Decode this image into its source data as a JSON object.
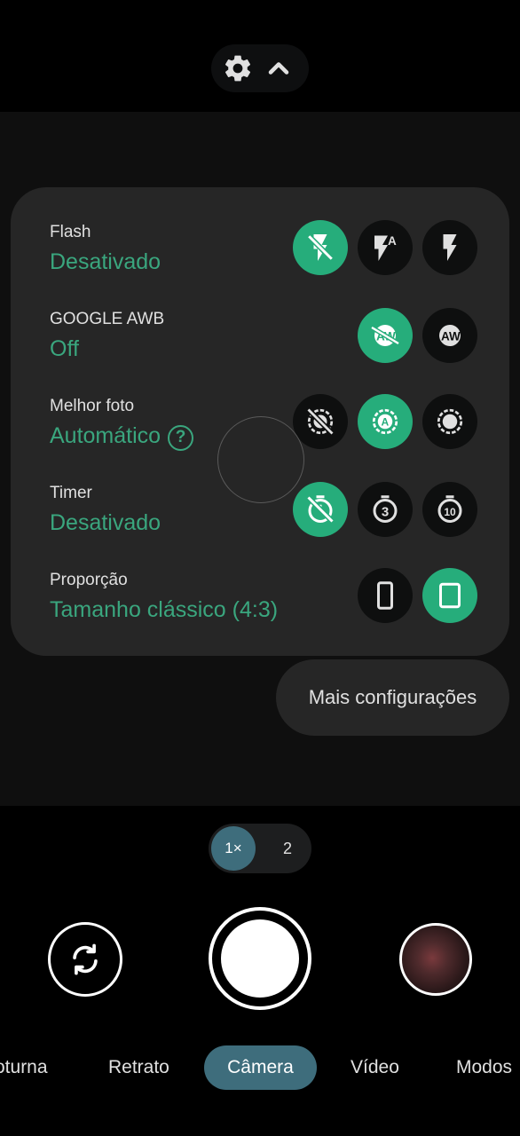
{
  "settings_panel": {
    "rows": [
      {
        "label": "Flash",
        "value": "Desativado"
      },
      {
        "label": "GOOGLE AWB",
        "value": "Off"
      },
      {
        "label": "Melhor foto",
        "value": "Automático",
        "help_icon": "help-circle-icon"
      },
      {
        "label": "Timer",
        "value": "Desativado"
      },
      {
        "label": "Proporção",
        "value": "Tamanho clássico (4:3)"
      }
    ],
    "flash_options": [
      {
        "icon": "flash-off-icon",
        "selected": true
      },
      {
        "icon": "flash-auto-icon",
        "selected": false,
        "glyph": "A"
      },
      {
        "icon": "flash-on-icon",
        "selected": false
      }
    ],
    "awb_options": [
      {
        "icon": "awb-off-icon",
        "selected": true,
        "glyph": "AW"
      },
      {
        "icon": "awb-on-icon",
        "selected": false,
        "glyph": "AW"
      }
    ],
    "best_photo_options": [
      {
        "icon": "motion-off-icon",
        "selected": false
      },
      {
        "icon": "motion-auto-icon",
        "selected": true,
        "glyph": "A"
      },
      {
        "icon": "motion-on-icon",
        "selected": false
      }
    ],
    "timer_options": [
      {
        "icon": "timer-off-icon",
        "selected": true
      },
      {
        "icon": "timer-3-icon",
        "selected": false,
        "glyph": "3"
      },
      {
        "icon": "timer-10-icon",
        "selected": false,
        "glyph": "10"
      }
    ],
    "ratio_options": [
      {
        "icon": "ratio-wide-icon",
        "selected": false
      },
      {
        "icon": "ratio-classic-icon",
        "selected": true
      }
    ]
  },
  "more_settings": "Mais configurações",
  "zoom": {
    "current": "1×",
    "other": "2"
  },
  "modes": [
    "oturna",
    "Retrato",
    "Câmera",
    "Vídeo",
    "Modos"
  ],
  "active_mode": "Câmera",
  "colors": {
    "accent": "#26ad7b",
    "value_text": "#3aa67e",
    "mode_pill": "#3e6d7c",
    "panel": "#262626"
  },
  "top_controls": {
    "settings_icon": "gear-icon",
    "collapse_icon": "chevron-up-icon"
  }
}
